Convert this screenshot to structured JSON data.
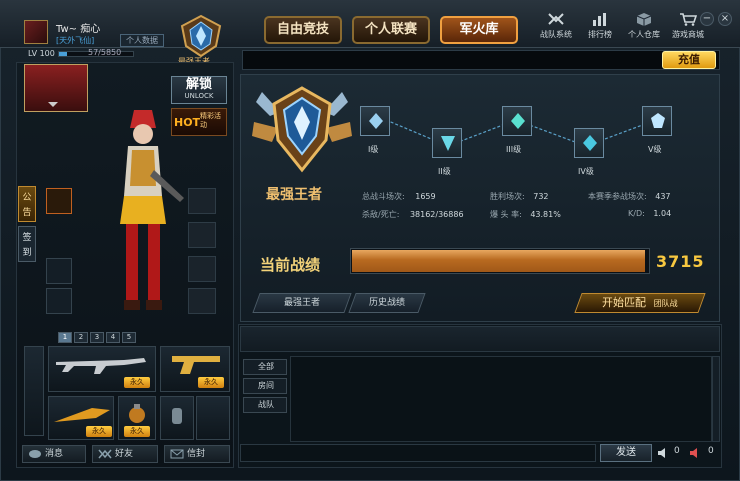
{
  "player": {
    "name": "Tw~ 痴心",
    "clan": "[天外飞仙]",
    "info_button": "个人数据",
    "level": "LV 100",
    "xp": "57/5850"
  },
  "rank_badge": "最强王者",
  "tabs": [
    "自由竞技",
    "个人联赛",
    "军火库"
  ],
  "active_tab": "军火库",
  "system_buttons": [
    "战队系统",
    "排行榜",
    "个人仓库",
    "游戏商城"
  ],
  "window_controls": [
    "−",
    "×"
  ],
  "recharge": "充值",
  "unlock": {
    "title": "解锁",
    "sub": "UNLOCK"
  },
  "hot": {
    "label": "HOT",
    "sub": "精彩活动"
  },
  "side_tabs": [
    "公告",
    "签到"
  ],
  "weapon_tabs": [
    "1",
    "2",
    "3",
    "4",
    "5"
  ],
  "permanent_label": "永久",
  "bottom_buttons": [
    "消息",
    "好友",
    "信封"
  ],
  "rank": {
    "name": "最强王者",
    "tiers": [
      "I级",
      "II级",
      "III级",
      "IV级",
      "V级"
    ]
  },
  "stats": [
    {
      "label": "总战斗场次:",
      "value": "1659"
    },
    {
      "label": "胜利场次:",
      "value": "732"
    },
    {
      "label": "本赛季参战场次:",
      "value": "437"
    },
    {
      "label": "杀敌/死亡:",
      "value": "38162/36886"
    },
    {
      "label": "爆 头 率:",
      "value": "43.81%"
    },
    {
      "label": "K/D:",
      "value": "1.04"
    }
  ],
  "performance": {
    "label": "当前战绩",
    "value": "3715",
    "fill_fraction": 0.99
  },
  "actions": {
    "strongest": "最强王者",
    "history": "历史战绩",
    "start": "开始匹配",
    "mode": "团队战"
  },
  "chat": {
    "channels": [
      "全部",
      "房间",
      "战队"
    ],
    "send": "发送",
    "counter_a": "0",
    "counter_b": "0"
  },
  "colors": {
    "accent_gold": "#f3d37a",
    "progress": "#b86a20",
    "active_tab": "#a0541a",
    "link_blue": "#4aa0d8"
  }
}
